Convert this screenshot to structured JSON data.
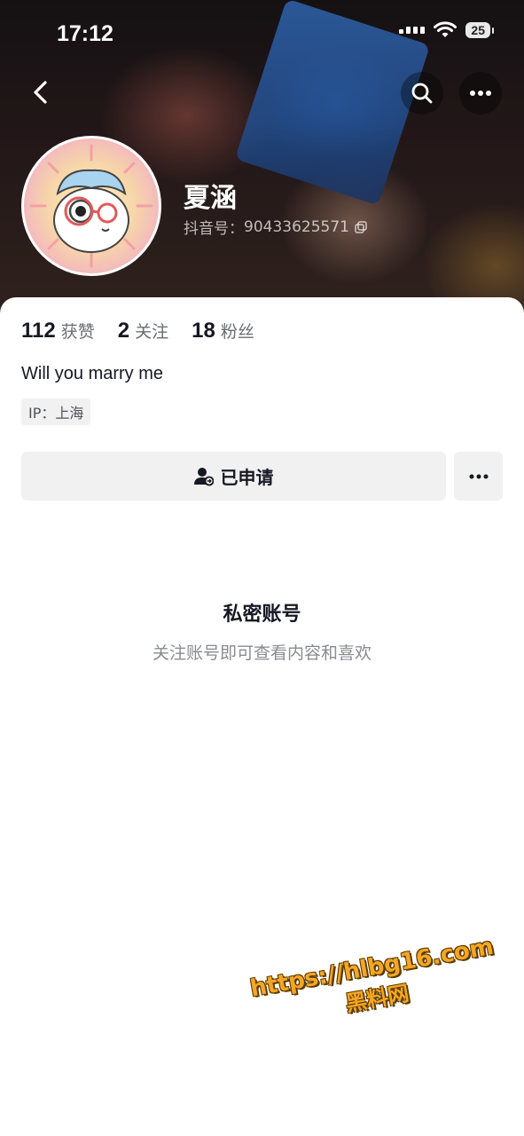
{
  "status_bar": {
    "time": "17:12",
    "battery": "25"
  },
  "header": {
    "back_icon": "chevron-left-icon",
    "search_icon": "search-icon",
    "more_icon": "more-horizontal-icon"
  },
  "profile": {
    "name": "夏涵",
    "id_label": "抖音号：",
    "id_value": "90433625571",
    "bio": "Will you marry me",
    "ip": "IP：上海"
  },
  "stats": [
    {
      "value": "112",
      "label": "获赞"
    },
    {
      "value": "2",
      "label": "关注"
    },
    {
      "value": "18",
      "label": "粉丝"
    }
  ],
  "actions": {
    "applied_label": "已申请",
    "more_icon": "more-horizontal-icon"
  },
  "private_notice": {
    "title": "私密账号",
    "subtitle": "关注账号即可查看内容和喜欢"
  },
  "watermark": {
    "url": "https://hlbg16.com",
    "name": "黑料网"
  },
  "colors": {
    "text_primary": "#161823",
    "text_secondary": "#6b6d73",
    "button_bg": "#f1f1f2",
    "watermark": "#f5a623"
  }
}
